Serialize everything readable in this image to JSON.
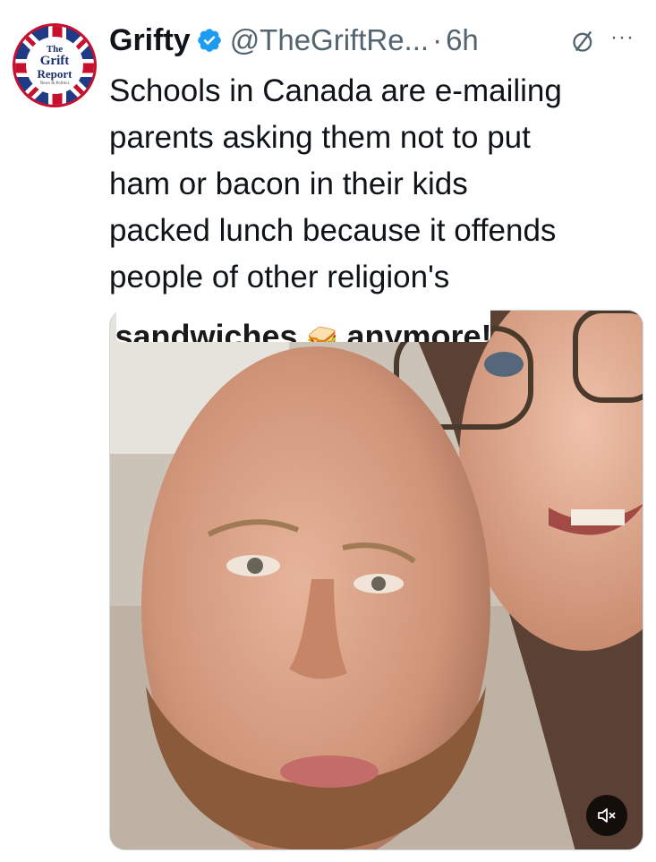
{
  "account": {
    "avatar_lines": [
      "The",
      "Grift",
      "Report",
      "News & Politics"
    ],
    "display_name": "Grifty",
    "handle": "@TheGriftRe...",
    "separator": "·",
    "time": "6h"
  },
  "tweet": {
    "lines": [
      "Schools in Canada are e-mailing",
      "parents asking them not to put",
      "ham or bacon in their kids",
      "packed lunch because it offends",
      "people of other religion's"
    ]
  },
  "media": {
    "caption_left": "sandwiches",
    "caption_emoji": "🥪",
    "caption_right": "anymore!"
  },
  "icons": {
    "verified": "verified-badge-icon",
    "grok": "grok-icon",
    "more": "more-icon",
    "mute": "speaker-muted-icon"
  },
  "colors": {
    "verified": "#1d9bf0",
    "secondary_text": "#536471",
    "primary_text": "#0f1419"
  }
}
